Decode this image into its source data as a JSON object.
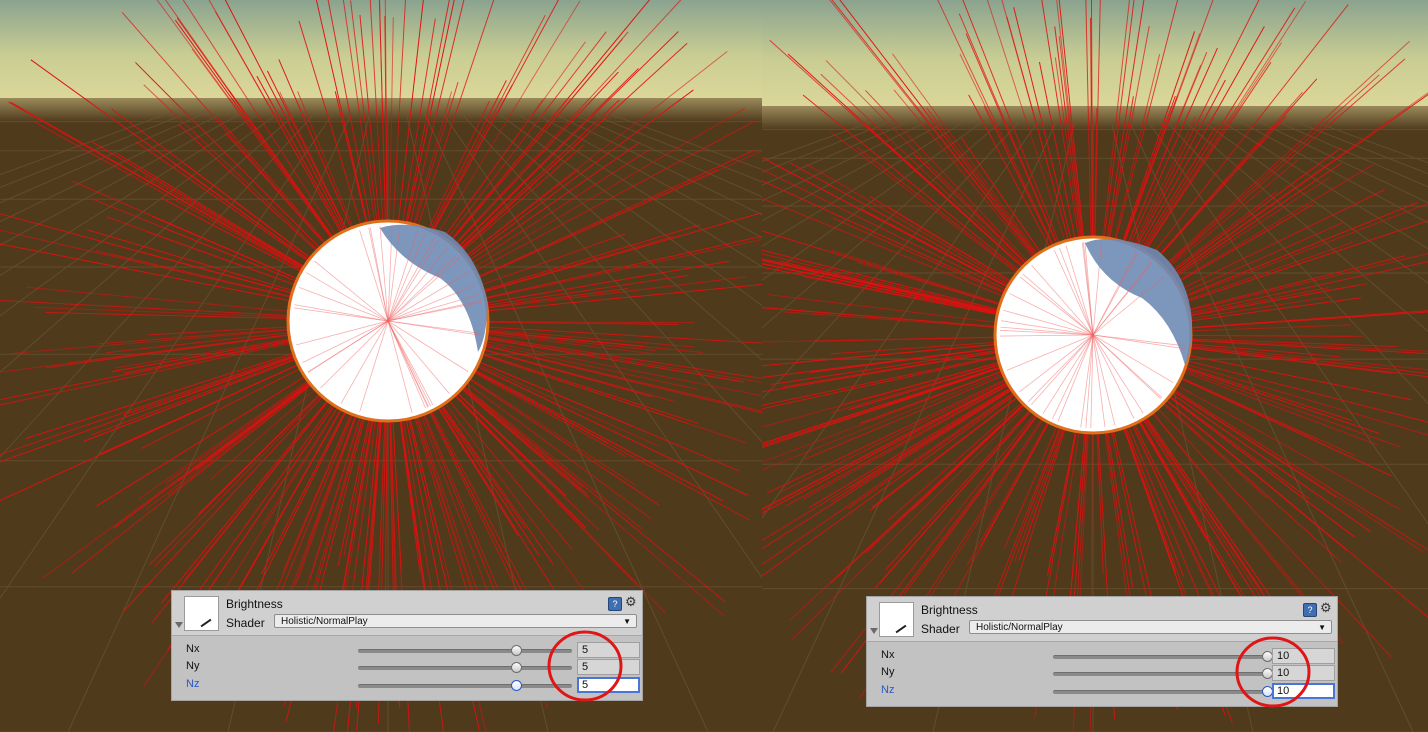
{
  "panels": [
    {
      "id": "left",
      "material": {
        "title": "Brightness",
        "shader_label": "Shader",
        "shader_value": "Holistic/NormalPlay"
      },
      "icons": {
        "help": "help-book-icon",
        "settings": "gear-icon",
        "fold": "foldout-arrow-icon"
      },
      "properties": [
        {
          "label": "Nx",
          "value": "5",
          "slider_fraction": 0.74,
          "focused": false
        },
        {
          "label": "Ny",
          "value": "5",
          "slider_fraction": 0.74,
          "focused": false
        },
        {
          "label": "Nz",
          "value": "5",
          "slider_fraction": 0.74,
          "focused": true
        }
      ]
    },
    {
      "id": "right",
      "material": {
        "title": "Brightness",
        "shader_label": "Shader",
        "shader_value": "Holistic/NormalPlay"
      },
      "icons": {
        "help": "help-book-icon",
        "settings": "gear-icon",
        "fold": "foldout-arrow-icon"
      },
      "properties": [
        {
          "label": "Nx",
          "value": "10",
          "slider_fraction": 1.0,
          "focused": false
        },
        {
          "label": "Ny",
          "value": "10",
          "slider_fraction": 1.0,
          "focused": false
        },
        {
          "label": "Nz",
          "value": "10",
          "slider_fraction": 1.0,
          "focused": true
        }
      ]
    }
  ],
  "colors": {
    "ground": "#4f3a1c",
    "sky_top": "#8aa38f",
    "sky_horizon": "#d8d596",
    "normal_lines": "#e01010",
    "annotation_circle": "#e01515",
    "focus_blue": "#2a56c6"
  }
}
